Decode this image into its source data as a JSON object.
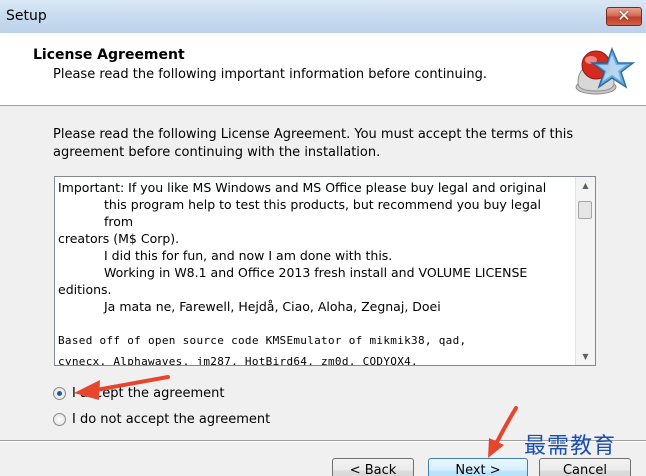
{
  "window": {
    "title": "Setup",
    "close_glyph": "✕"
  },
  "header": {
    "title": "License Agreement",
    "subtitle": "Please read the following important information before continuing.",
    "logo_icon": "setup-wizard-logo"
  },
  "intro": "Please read the following License Agreement. You must accept the terms of this agreement before continuing with the installation.",
  "license": {
    "lines": [
      "Important: If you like MS Windows and MS Office please buy legal and original",
      "this program help to test this products, but recommend you buy legal from",
      "creators (M$ Corp).",
      "I did this for fun, and now I am done with this.",
      "Working in W8.1 and Office 2013 fresh install and VOLUME LICENSE",
      "editions.",
      "Ja mata ne, Farewell, Hejdå, Ciao, Aloha, Zegnaj, Doei",
      "Based off of open source code KMSEmulator of mikmik38, qad,",
      "cynecx, Alphawaves, jm287, HotBird64, zm0d, CODYQX4."
    ]
  },
  "options": {
    "accept": "I accept the agreement",
    "decline": "I do not accept the agreement",
    "selected": "accept"
  },
  "buttons": {
    "back": "< Back",
    "next": "Next >",
    "cancel": "Cancel"
  },
  "watermark": "最需教育",
  "colors": {
    "annotation_arrow": "#e8452e",
    "watermark": "#1a4fb0"
  }
}
